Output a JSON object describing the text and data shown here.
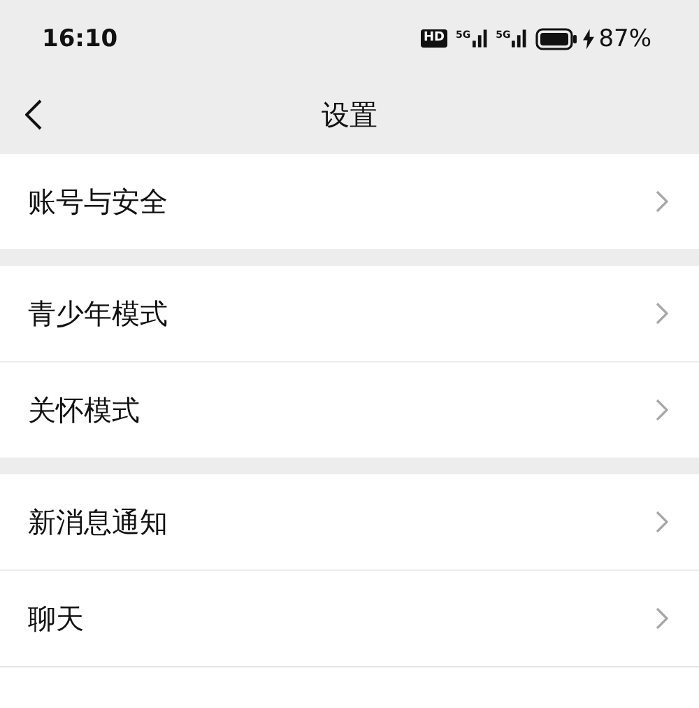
{
  "status_bar": {
    "time": "16:10",
    "hd": "HD",
    "networks": [
      {
        "label": "5G"
      },
      {
        "label": "5G"
      }
    ],
    "charging": true,
    "battery_text": "87%"
  },
  "header": {
    "title": "设置"
  },
  "sections": [
    {
      "items": [
        {
          "label": "账号与安全"
        }
      ]
    },
    {
      "items": [
        {
          "label": "青少年模式"
        },
        {
          "label": "关怀模式"
        }
      ]
    },
    {
      "items": [
        {
          "label": "新消息通知"
        },
        {
          "label": "聊天"
        }
      ]
    }
  ]
}
